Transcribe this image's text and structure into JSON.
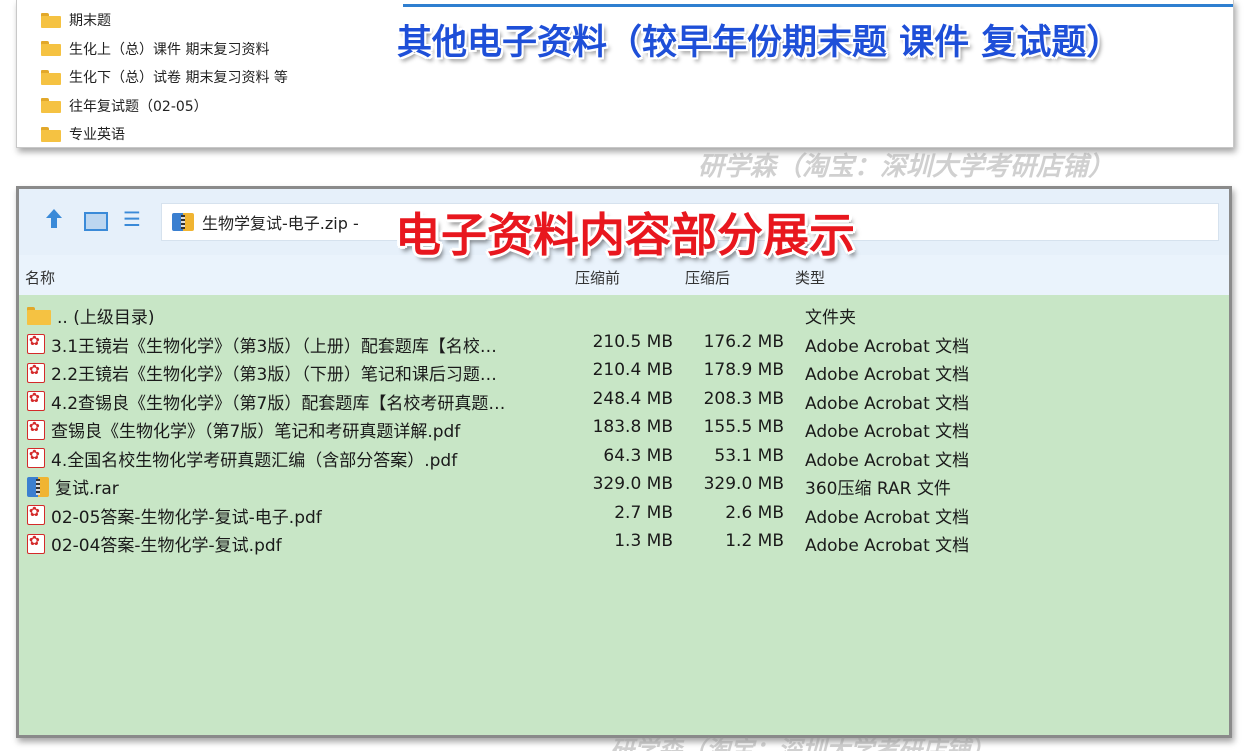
{
  "top_panel": {
    "headline": "其他电子资料（较早年份期末题 课件 复试题）",
    "folders": [
      {
        "label": "期末题",
        "icon": "folder-icon"
      },
      {
        "label": "生化上（总）课件 期末复习资料",
        "icon": "folder-icon"
      },
      {
        "label": "生化下（总）试卷 期末复习资料 等",
        "icon": "folder-icon"
      },
      {
        "label": "往年复试题（02-05）",
        "icon": "folder-icon"
      },
      {
        "label": "专业英语",
        "icon": "folder-icon"
      }
    ]
  },
  "watermark_top": "研学森（淘宝：深圳大学考研店铺）",
  "watermark_bottom": "研学森（淘宝：深圳大学考研店铺）",
  "archive_window": {
    "headline": "电子资料内容部分展示",
    "address": "生物学复试-电子.zip -",
    "toolbar_icons": [
      "up-arrow-icon",
      "view-mode-icon",
      "list-view-icon"
    ],
    "columns": {
      "name": "名称",
      "size_before": "压缩前",
      "size_after": "压缩后",
      "type": "类型"
    },
    "rows": [
      {
        "icon": "folder-icon",
        "name": ".. (上级目录)",
        "before": "",
        "after": "",
        "type": "文件夹"
      },
      {
        "icon": "pdf-icon",
        "name": "3.1王镜岩《生物化学》（第3版）（上册）配套题库【名校…",
        "before": "210.5 MB",
        "after": "176.2 MB",
        "type": "Adobe Acrobat 文档"
      },
      {
        "icon": "pdf-icon",
        "name": "2.2王镜岩《生物化学》（第3版）（下册）笔记和课后习题…",
        "before": "210.4 MB",
        "after": "178.9 MB",
        "type": "Adobe Acrobat 文档"
      },
      {
        "icon": "pdf-icon",
        "name": "4.2查锡良《生物化学》（第7版）配套题库【名校考研真题…",
        "before": "248.4 MB",
        "after": "208.3 MB",
        "type": "Adobe Acrobat 文档"
      },
      {
        "icon": "pdf-icon",
        "name": "查锡良《生物化学》（第7版）笔记和考研真题详解.pdf",
        "before": "183.8 MB",
        "after": "155.5 MB",
        "type": "Adobe Acrobat 文档"
      },
      {
        "icon": "pdf-icon",
        "name": "4.全国名校生物化学考研真题汇编（含部分答案）.pdf",
        "before": "64.3 MB",
        "after": "53.1 MB",
        "type": "Adobe Acrobat 文档"
      },
      {
        "icon": "rar-icon",
        "name": "复试.rar",
        "before": "329.0 MB",
        "after": "329.0 MB",
        "type": "360压缩 RAR 文件"
      },
      {
        "icon": "pdf-icon",
        "name": "02-05答案-生物化学-复试-电子.pdf",
        "before": "2.7 MB",
        "after": "2.6 MB",
        "type": "Adobe Acrobat 文档"
      },
      {
        "icon": "pdf-icon",
        "name": "02-04答案-生物化学-复试.pdf",
        "before": "1.3 MB",
        "after": "1.2 MB",
        "type": "Adobe Acrobat 文档"
      }
    ]
  },
  "colors": {
    "list_background": "#c8e6c6",
    "toolbar_background": "#e6f0fa",
    "headline_blue": "#1e4fd8",
    "headline_red": "#e8171e",
    "folder_yellow": "#f5c242",
    "pdf_red": "#d42a2a"
  }
}
